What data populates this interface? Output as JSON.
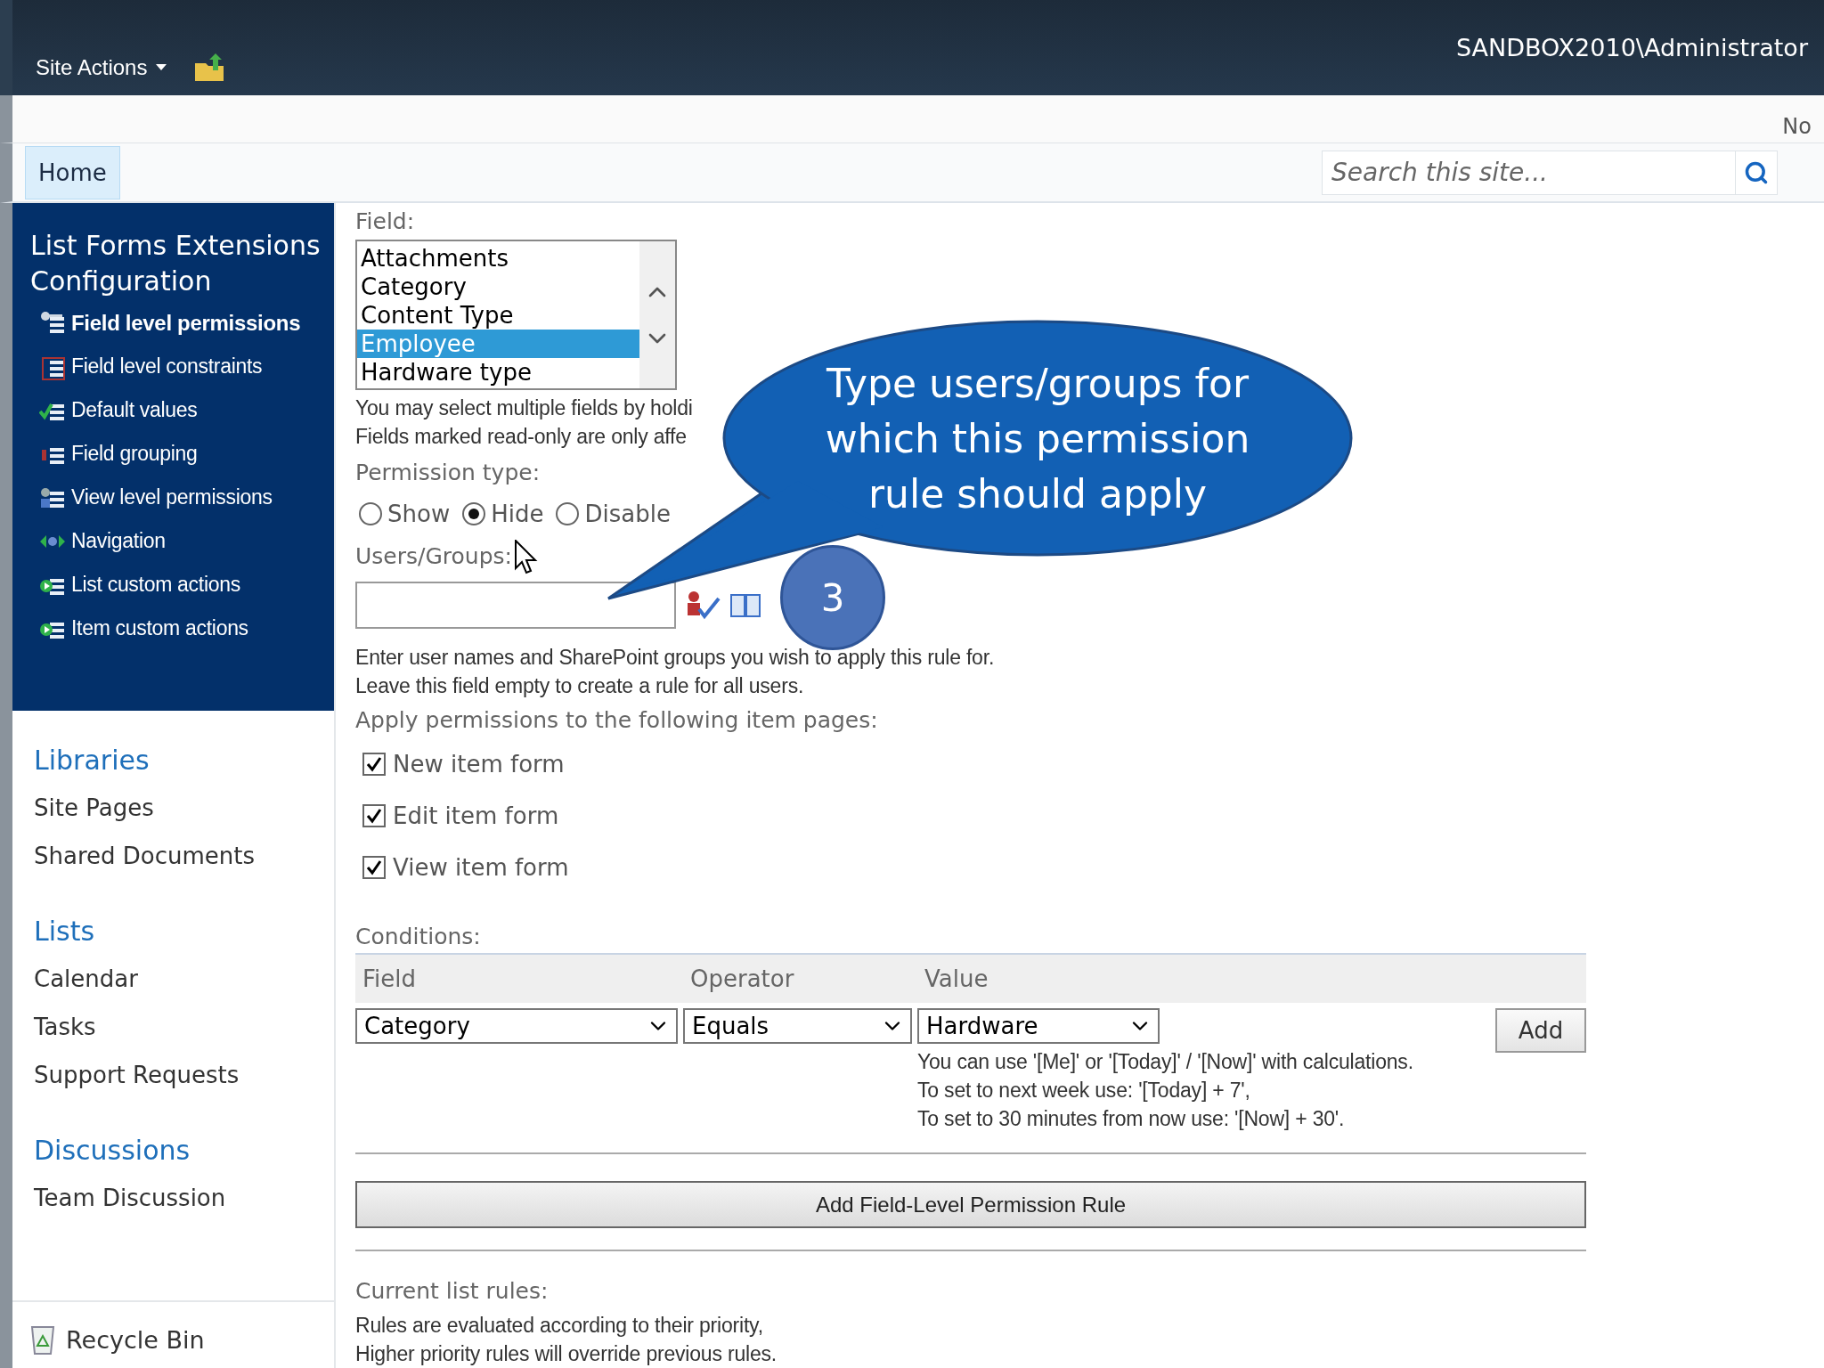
{
  "top_bar": {
    "site_actions": "Site Actions",
    "user": "SANDBOX2010\\Administrator"
  },
  "ribbon_band": {
    "text": "No"
  },
  "top_nav": {
    "tabs": [
      {
        "label": "Home",
        "selected": true
      }
    ],
    "search": {
      "placeholder": "Search this site..."
    }
  },
  "sidebar": {
    "title": "List Forms Extensions Configuration",
    "items": [
      {
        "label": "Field level permissions",
        "selected": true,
        "kind": "key"
      },
      {
        "label": "Field level constraints",
        "selected": false,
        "kind": "list"
      },
      {
        "label": "Default values",
        "selected": false,
        "kind": "check"
      },
      {
        "label": "Field grouping",
        "selected": false,
        "kind": "group"
      },
      {
        "label": "View level permissions",
        "selected": false,
        "kind": "users"
      },
      {
        "label": "Navigation",
        "selected": false,
        "kind": "arrows"
      },
      {
        "label": "List custom actions",
        "selected": false,
        "kind": "play"
      },
      {
        "label": "Item custom actions",
        "selected": false,
        "kind": "play"
      }
    ],
    "quick_launch": [
      {
        "heading": "Libraries",
        "items": [
          "Site Pages",
          "Shared Documents"
        ]
      },
      {
        "heading": "Lists",
        "items": [
          "Calendar",
          "Tasks",
          "Support Requests"
        ]
      },
      {
        "heading": "Discussions",
        "items": [
          "Team Discussion"
        ]
      }
    ],
    "recycle_bin": "Recycle Bin"
  },
  "form": {
    "field_label": "Field:",
    "field_options": [
      {
        "label": "Attachments",
        "selected": false
      },
      {
        "label": "Category",
        "selected": false
      },
      {
        "label": "Content Type",
        "selected": false
      },
      {
        "label": "Employee",
        "selected": true
      },
      {
        "label": "Hardware type",
        "selected": false
      }
    ],
    "field_help": [
      "You may select multiple fields by holdi",
      "Fields marked read-only are only affe"
    ],
    "permission_label": "Permission type:",
    "permission_options": [
      {
        "label": "Show",
        "selected": false
      },
      {
        "label": "Hide",
        "selected": true
      },
      {
        "label": "Disable",
        "selected": false
      }
    ],
    "users_label": "Users/Groups:",
    "users_help": [
      "Enter user names and SharePoint groups you wish to apply this rule for.",
      "Leave this field empty to create a rule for all users."
    ],
    "pages_label": "Apply permissions to the following item pages:",
    "pages": [
      {
        "label": "New item form",
        "checked": true
      },
      {
        "label": "Edit item form",
        "checked": true
      },
      {
        "label": "View item form",
        "checked": true
      }
    ],
    "conditions_label": "Conditions:",
    "condition_columns": [
      "Field",
      "Operator",
      "Value"
    ],
    "condition_values": [
      "Category",
      "Equals",
      "Hardware"
    ],
    "add_button": "Add",
    "condition_help": [
      "You can use '[Me]' or '[Today]' / '[Now]' with calculations.",
      "To set to next week use: '[Today] + 7',",
      "To set to 30 minutes from now use: '[Now] + 30'."
    ],
    "submit_button": "Add Field-Level Permission Rule",
    "rules_label": "Current list rules:",
    "rules_help": [
      "Rules are evaluated according to their priority,",
      "Higher priority rules will override previous rules."
    ]
  },
  "callout": {
    "text": "Type users/groups for which this permission rule should apply"
  },
  "step_badge": {
    "text": "3"
  }
}
